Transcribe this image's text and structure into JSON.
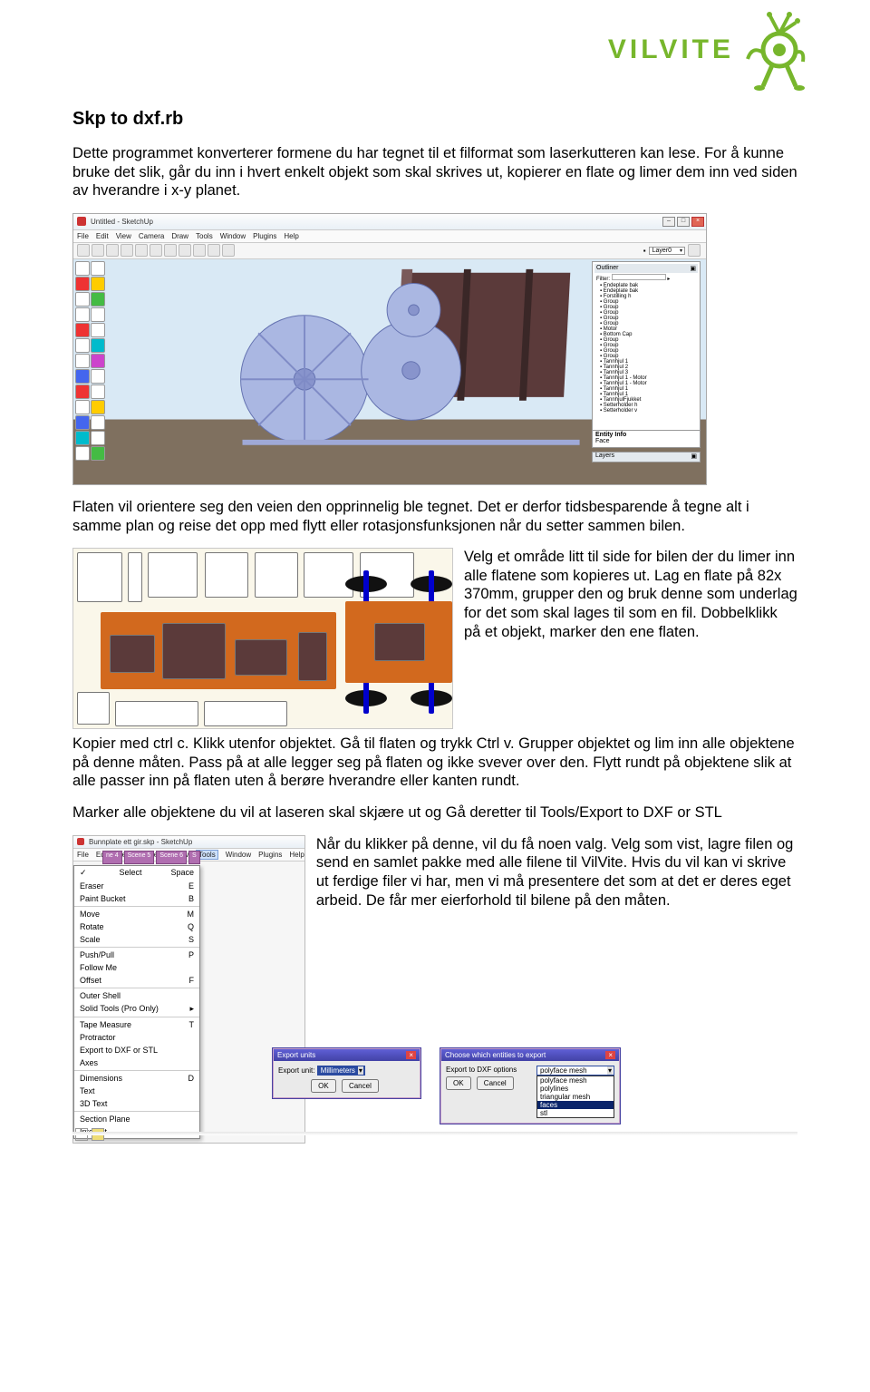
{
  "logo": "VILVITE",
  "heading": "Skp to dxf.rb",
  "para1": "Dette programmet konverterer formene du har tegnet til et filformat som laserkutteren kan lese. For å kunne bruke det slik, går du inn i hvert enkelt objekt som skal skrives ut, kopierer en flate og limer dem inn ved siden av hverandre i x-y planet.",
  "para2": "Flaten vil orientere seg den veien den opprinnelig ble tegnet. Det er derfor tidsbesparende å tegne alt i samme plan og reise det opp med flytt eller rotasjonsfunksjonen når du setter sammen bilen.",
  "para3_side": "Velg et område litt til side for bilen der du limer inn alle flatene som kopieres ut. Lag en flate på 82x 370mm, grupper den og bruk denne som underlag for det som skal lages til som en fil. Dobbelklikk på et objekt, marker den ene flaten.",
  "para3_cont": "Kopier med ctrl c. Klikk utenfor objektet. Gå til flaten og trykk Ctrl v. Grupper objektet og lim inn alle objektene på denne måten. Pass på at alle legger seg på flaten og ikke svever over den. Flytt rundt på objektene slik at alle passer inn på flaten uten å berøre hverandre eller kanten rundt.",
  "para4": "Marker alle objektene du vil at laseren skal skjære ut og Gå deretter til Tools/Export to DXF or STL",
  "para5": "Når du klikker på denne, vil du få noen valg. Velg som vist, lagre filen og send en samlet pakke med alle filene til VilVite. Hvis du vil kan vi skrive ut ferdige filer vi har, men vi må presentere det som at det er deres eget arbeid. De får mer eierforhold til bilene på den måten.",
  "sketchup": {
    "title": "Untitled - SketchUp",
    "menu": [
      "File",
      "Edit",
      "View",
      "Camera",
      "Draw",
      "Tools",
      "Window",
      "Plugins",
      "Help"
    ],
    "layer_label": "Layer0",
    "outliner": {
      "title": "Outliner",
      "filter": "Filter:",
      "items": [
        "Endeplate bak",
        "Endeplate bak",
        "Forstilling h",
        "Group",
        "Group",
        "Group",
        "Group",
        "Group",
        "Motor",
        "  Bottom Cap",
        "  Group",
        "  Group",
        "  Group",
        "  Group",
        "Tannhjul 1",
        "Tannhjul 2",
        "Tannhjul 3",
        "Tannhjul 1 - Motor",
        "Tannhjul 1 - Motor",
        "Tannhjul 1",
        "Tannhjul 1",
        "TannhjulFjukket",
        "Setterholder h",
        "Setterholder v"
      ]
    },
    "entity_label": "Entity Info",
    "face_label": "Face",
    "layers_label": "Layers"
  },
  "toolsmenu": {
    "window_title": "Bunnplate ett gir.skp - SketchUp",
    "menu": [
      "File",
      "Edit",
      "View",
      "Camera",
      "Draw",
      "Tools",
      "Window",
      "Plugins",
      "Help"
    ],
    "scenes": [
      "ne 4",
      "Scene 5",
      "Scene 6",
      "S"
    ],
    "items": [
      {
        "label": "Select",
        "k": "Space",
        "chk": true
      },
      {
        "label": "Eraser",
        "k": "E"
      },
      {
        "label": "Paint Bucket",
        "k": "B"
      },
      {
        "sep": true
      },
      {
        "label": "Move",
        "k": "M"
      },
      {
        "label": "Rotate",
        "k": "Q"
      },
      {
        "label": "Scale",
        "k": "S"
      },
      {
        "sep": true
      },
      {
        "label": "Push/Pull",
        "k": "P"
      },
      {
        "label": "Follow Me",
        "k": ""
      },
      {
        "label": "Offset",
        "k": "F"
      },
      {
        "sep": true
      },
      {
        "label": "Outer Shell",
        "k": ""
      },
      {
        "label": "Solid Tools (Pro Only)",
        "k": "▸"
      },
      {
        "sep": true
      },
      {
        "label": "Tape Measure",
        "k": "T"
      },
      {
        "label": "Protractor",
        "k": ""
      },
      {
        "label": "Export to DXF or STL",
        "k": ""
      },
      {
        "label": "Axes",
        "k": ""
      },
      {
        "sep": true
      },
      {
        "label": "Dimensions",
        "k": "D"
      },
      {
        "label": "Text",
        "k": ""
      },
      {
        "label": "3D Text",
        "k": ""
      },
      {
        "sep": true
      },
      {
        "label": "Section Plane",
        "k": ""
      },
      {
        "label": "Interact",
        "k": ""
      }
    ]
  },
  "dialog1": {
    "title": "Export units",
    "label": "Export unit:",
    "value": "Millimeters",
    "ok": "OK",
    "cancel": "Cancel"
  },
  "dialog2": {
    "title": "Choose which entities to export",
    "label": "Export to DXF options",
    "listvalue": "polyface mesh",
    "list": [
      "polyface mesh",
      "polylines",
      "triangular mesh",
      "faces",
      "stl"
    ],
    "ok": "OK",
    "cancel": "Cancel"
  }
}
